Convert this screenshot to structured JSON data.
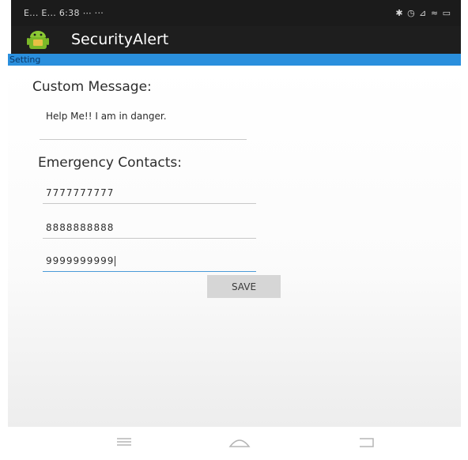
{
  "status_bar": {
    "left_text": "E... E... 6:38 ⋯ ···",
    "right_text": "✱ ◷ ⊿ ≈ ▭"
  },
  "app_bar": {
    "title": "SecurityAlert",
    "icon": "android-icon",
    "color": "#1e1e1e"
  },
  "section": {
    "title": "Setting",
    "color": "#2a8fdd"
  },
  "form": {
    "message_label": "Custom Message:",
    "message_value": "Help Me!! I am in danger.",
    "contacts_label": "Emergency Contacts:",
    "contacts": [
      "7777777777",
      "8888888888",
      "9999999999"
    ],
    "save_label": "SAVE"
  },
  "nav_bar": {
    "menu_icon": "menu-icon",
    "home_icon": "home-icon",
    "back_icon": "back-icon"
  }
}
